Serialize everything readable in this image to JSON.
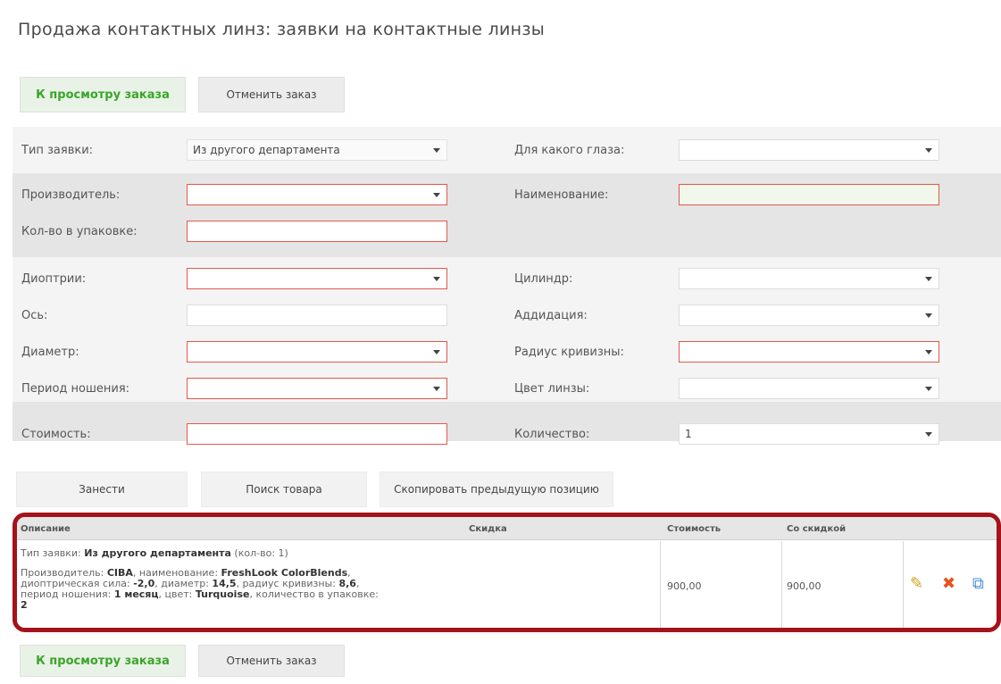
{
  "page": {
    "title": "Продажа контактных линз: заявки на контактные линзы"
  },
  "top_buttons": {
    "view_order": "К просмотру заказа",
    "cancel_order": "Отменить заказ"
  },
  "form": {
    "order_type": {
      "label": "Тип заявки:",
      "value": "Из другого департамента"
    },
    "eye": {
      "label": "Для какого глаза:",
      "value": ""
    },
    "manufacturer": {
      "label": "Производитель:",
      "value": ""
    },
    "name": {
      "label": "Наименование:",
      "value": ""
    },
    "pack_qty": {
      "label": "Кол-во в упаковке:",
      "value": ""
    },
    "diopters": {
      "label": "Диоптрии:",
      "value": ""
    },
    "cylinder": {
      "label": "Цилиндр:",
      "value": ""
    },
    "axis": {
      "label": "Ось:",
      "value": ""
    },
    "addition": {
      "label": "Аддидация:",
      "value": ""
    },
    "diameter": {
      "label": "Диаметр:",
      "value": ""
    },
    "curvature": {
      "label": "Радиус кривизны:",
      "value": ""
    },
    "wear_period": {
      "label": "Период ношения:",
      "value": ""
    },
    "lens_color": {
      "label": "Цвет линзы:",
      "value": ""
    },
    "cost": {
      "label": "Стоимость:",
      "value": ""
    },
    "quantity": {
      "label": "Количество:",
      "value": "1"
    }
  },
  "action_buttons": {
    "add": "Занести",
    "search": "Поиск товара",
    "copy_prev": "Скопировать предыдущую позицию"
  },
  "table": {
    "headers": {
      "description": "Описание",
      "discount": "Скидка",
      "cost": "Стоимость",
      "discounted": "Со скидкой"
    },
    "row": {
      "l1_a": "Тип заявки: ",
      "l1_b": "Из другого департамента",
      "l1_c": " (кол-во: 1)",
      "l2_a": "Производитель: ",
      "l2_b": "CIBA",
      "l2_c": ", наименование: ",
      "l2_d": "FreshLook ColorBlends",
      "l3_a": "диоптрическая сила: ",
      "l3_b": "-2,0",
      "l3_c": ", диаметр: ",
      "l3_d": "14,5",
      "l3_e": ", радиус кривизны: ",
      "l3_f": "8,6",
      "l4_a": "период ношения: ",
      "l4_b": "1 месяц",
      "l4_c": ", цвет: ",
      "l4_d": "Turquoise",
      "l4_e": ", количество в упаковке:",
      "l5": "2",
      "discount": "",
      "cost": "900,00",
      "discounted": "900,00"
    }
  },
  "bottom_buttons": {
    "view_order": "К просмотру заказа",
    "cancel_order": "Отменить заказ"
  },
  "colors": {
    "accent_green": "#3aa52b",
    "required_border": "#e4584a",
    "highlight_frame": "#a4131b"
  }
}
